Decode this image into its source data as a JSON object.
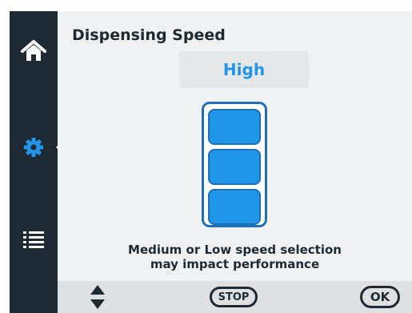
{
  "sidebar": {
    "items": [
      {
        "name": "home",
        "icon": "home-icon",
        "active": false
      },
      {
        "name": "settings",
        "icon": "gear-icon",
        "active": true
      },
      {
        "name": "list",
        "icon": "list-icon",
        "active": false
      }
    ]
  },
  "page": {
    "title": "Dispensing Speed",
    "value": "High",
    "level": {
      "current": 3,
      "max": 3
    },
    "warning_line1": "Medium or Low speed selection",
    "warning_line2": "may impact performance"
  },
  "footer": {
    "updown_icon": "up-down-arrows-icon",
    "stop_label": "STOP",
    "ok_label": "OK"
  },
  "colors": {
    "accent": "#2196e8",
    "accent_dark": "#1d6fb8",
    "sidebar": "#1e2a33",
    "background": "#f1f2f3"
  }
}
